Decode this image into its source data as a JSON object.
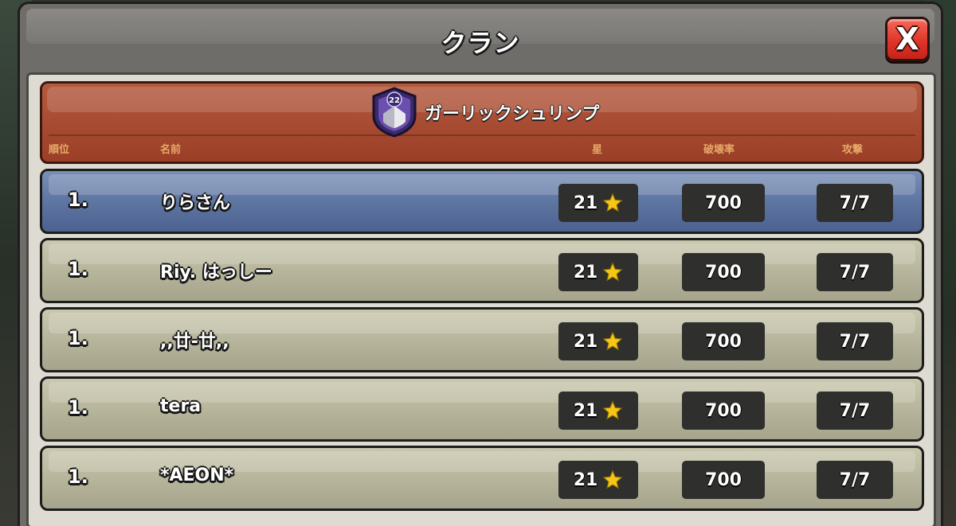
{
  "window": {
    "title": "クラン",
    "close_label": "X"
  },
  "clan": {
    "name": "ガーリックシュリンプ",
    "level": "22"
  },
  "columns": {
    "rank": "順位",
    "name": "名前",
    "stars": "星",
    "destruction": "破壊率",
    "attacks": "攻撃"
  },
  "players": [
    {
      "rank": "1.",
      "name": "りらさん",
      "stars": "21",
      "destruction": "700",
      "attacks": "7/7",
      "self": true
    },
    {
      "rank": "1.",
      "name": "Riy. はっしー",
      "stars": "21",
      "destruction": "700",
      "attacks": "7/7",
      "self": false
    },
    {
      "rank": "1.",
      "name": ",,廿-廿,,",
      "stars": "21",
      "destruction": "700",
      "attacks": "7/7",
      "self": false
    },
    {
      "rank": "1.",
      "name": "tera",
      "stars": "21",
      "destruction": "700",
      "attacks": "7/7",
      "self": false
    },
    {
      "rank": "1.",
      "name": "*AEON*",
      "stars": "21",
      "destruction": "700",
      "attacks": "7/7",
      "self": false
    }
  ],
  "colors": {
    "self_row": "#6078a4",
    "normal_row": "#b9b79d",
    "clan_header": "#9a3f26",
    "close_button": "#e0352a",
    "star": "#f5c518"
  },
  "icons": {
    "close": "close-icon",
    "clan_badge": "clan-badge-icon",
    "star": "star-icon"
  }
}
